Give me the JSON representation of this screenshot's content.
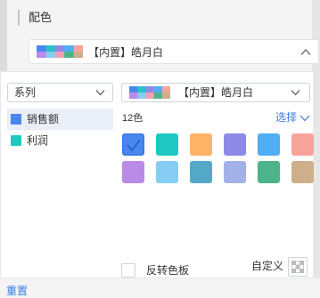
{
  "section": {
    "title": "配色"
  },
  "top_select": {
    "value": "【内置】皓月白"
  },
  "series_select": {
    "value": "系列"
  },
  "palette_select": {
    "value": "【内置】皓月白"
  },
  "series": [
    {
      "label": "销售额",
      "color": "#4a86f0",
      "active": true
    },
    {
      "label": "利润",
      "color": "#1ec8c0",
      "active": false
    }
  ],
  "palette": {
    "count_label": "12色",
    "choose_label": "选择",
    "colors": [
      "#4a86f0",
      "#1ec8c0",
      "#ffb366",
      "#8d8ae6",
      "#4faef5",
      "#f7a49a",
      "#b98be6",
      "#87cdf3",
      "#53a8c8",
      "#a3b2e6",
      "#4cb48a",
      "#cfae8c"
    ],
    "selected_index": 0
  },
  "reverse": {
    "label": "反转色板",
    "checked": false
  },
  "custom": {
    "label": "自定义"
  },
  "footer": {
    "reset_label": "重置"
  },
  "swatch_colors": {
    "top_row": [
      "#4a86f0",
      "#2dc0c6",
      "#8d8ae6",
      "#4faef5",
      "#f7a49a"
    ],
    "bottom_row": [
      "#b98be6",
      "#87cdf3",
      "#f0a0b4",
      "#4cb48a",
      "#cfae8c"
    ]
  }
}
